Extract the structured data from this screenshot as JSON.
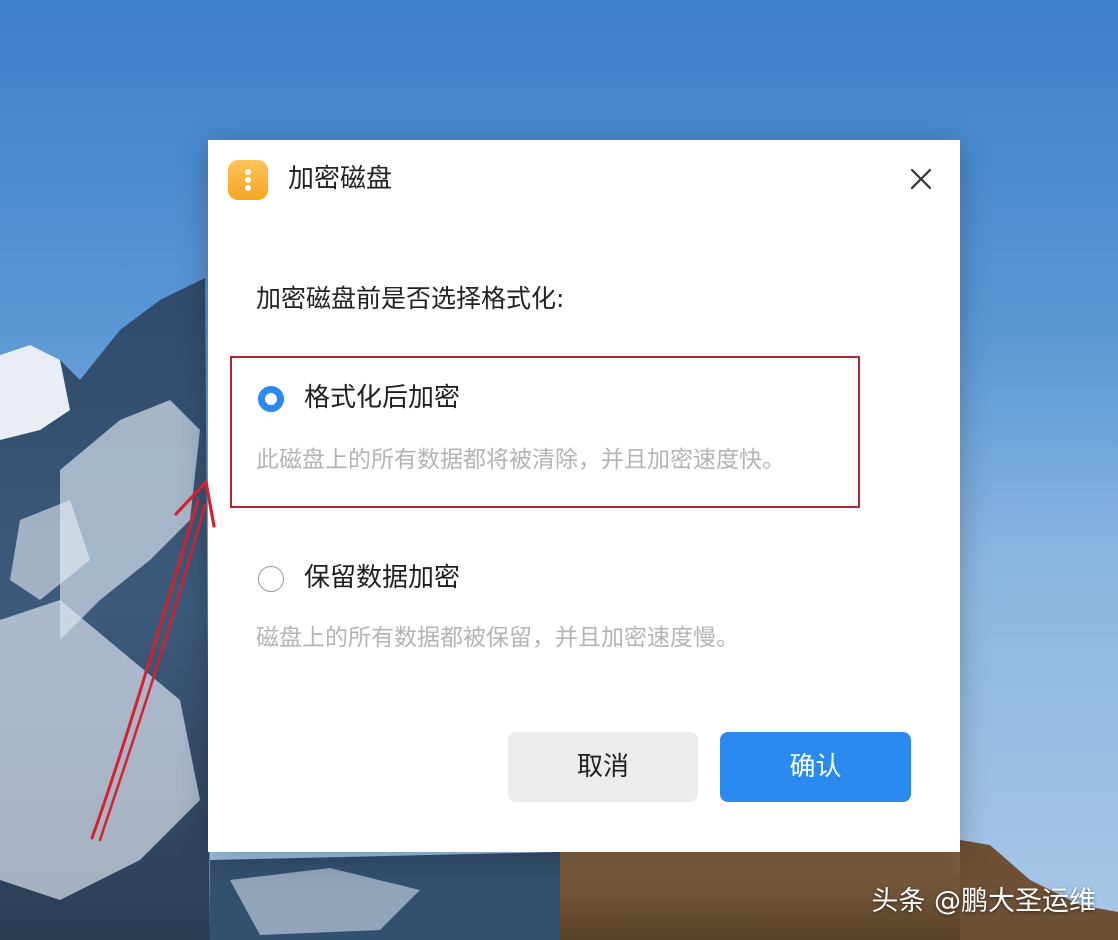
{
  "dialog": {
    "title": "加密磁盘",
    "icon": "app-icon",
    "close_icon": "close-icon"
  },
  "question": "加密磁盘前是否选择格式化:",
  "options": [
    {
      "label": "格式化后加密",
      "description": "此磁盘上的所有数据都将被清除，并且加密速度快。",
      "selected": true
    },
    {
      "label": "保留数据加密",
      "description": "磁盘上的所有数据都被保留，并且加密速度慢。",
      "selected": false
    }
  ],
  "buttons": {
    "cancel": "取消",
    "confirm": "确认"
  },
  "watermark": "头条 @鹏大圣运维",
  "colors": {
    "accent": "#2b8af0",
    "highlight_border": "#b0262c",
    "arrow": "#d9202a",
    "icon_orange": "#f5a623"
  }
}
